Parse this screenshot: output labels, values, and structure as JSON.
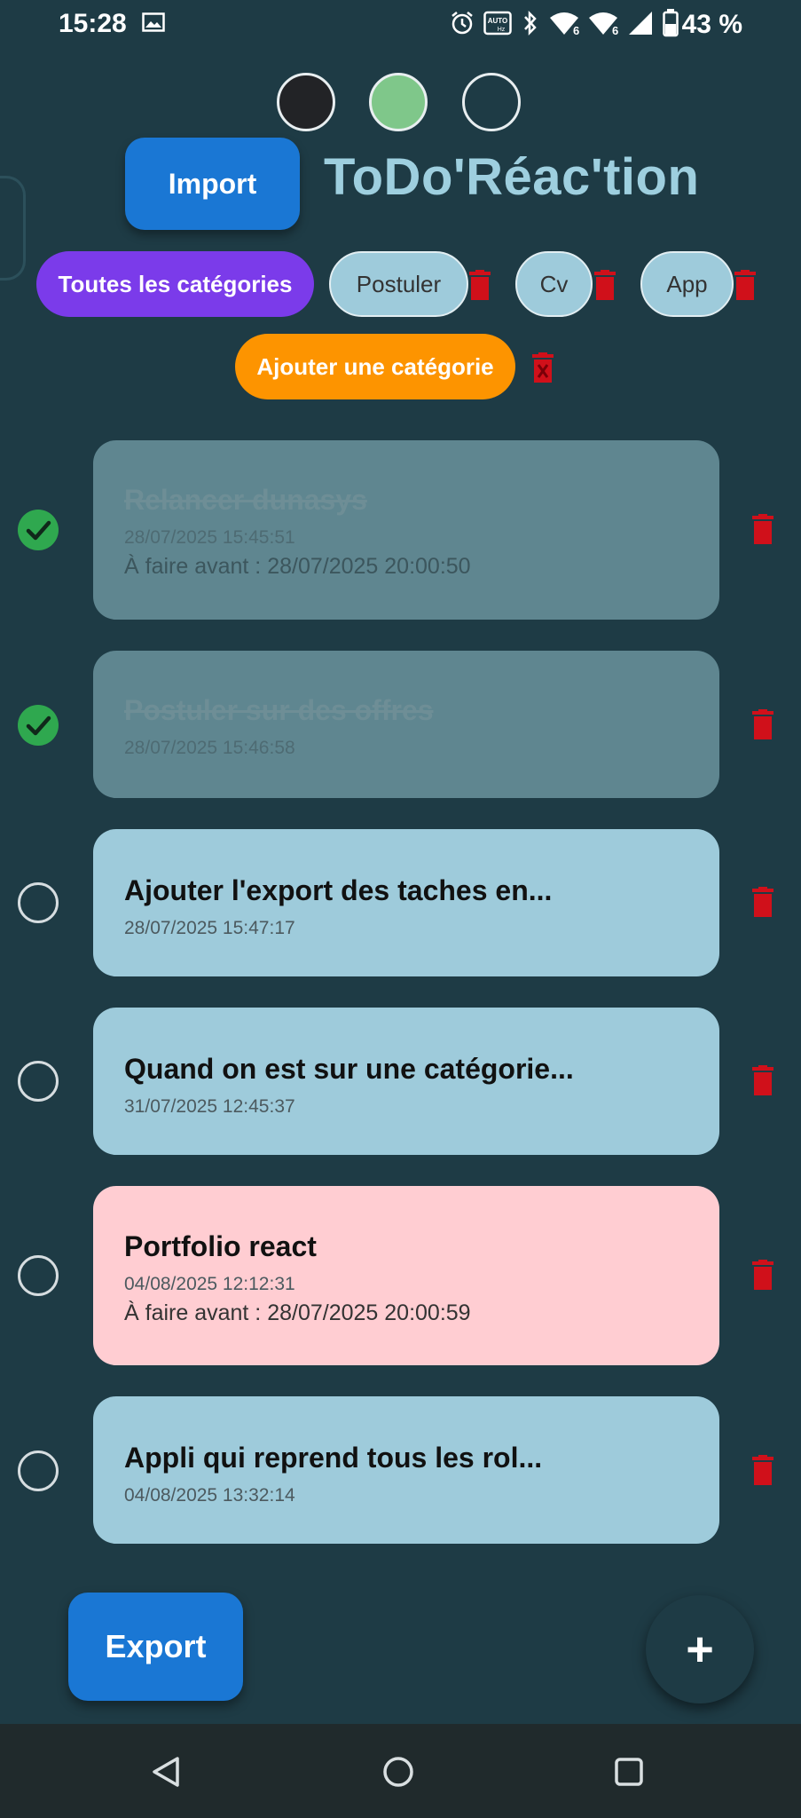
{
  "status_bar": {
    "time": "15:28",
    "battery": "43 %",
    "icons": [
      "image-icon",
      "alarm-icon",
      "auto-hd-icon",
      "bluetooth-icon",
      "wifi-6-icon",
      "wifi-6-icon",
      "signal-icon",
      "battery-icon"
    ]
  },
  "theme_dots": [
    "#222326",
    "#7fc78a",
    "transparent"
  ],
  "header": {
    "import_label": "Import",
    "title": "ToDo'Réac'tion"
  },
  "categories": {
    "all_label": "Toutes les catégories",
    "items": [
      {
        "label": "Postuler"
      },
      {
        "label": "Cv"
      },
      {
        "label": "App"
      }
    ],
    "add_label": "Ajouter une catégorie"
  },
  "tasks": [
    {
      "title": "Relancer dunasys",
      "created": "28/07/2025 15:45:51",
      "due": "À faire avant : 28/07/2025 20:00:50",
      "done": true
    },
    {
      "title": "Postuler sur des offres",
      "created": "28/07/2025 15:46:58",
      "due": "",
      "done": true
    },
    {
      "title": "Ajouter l'export des taches en...",
      "created": "28/07/2025 15:47:17",
      "due": "",
      "done": false
    },
    {
      "title": "Quand on est sur une catégorie...",
      "created": "31/07/2025 12:45:37",
      "due": "",
      "done": false
    },
    {
      "title": "Portfolio react",
      "created": "04/08/2025 12:12:31",
      "due": "À faire avant : 28/07/2025 20:00:59",
      "done": false,
      "overdue": true
    },
    {
      "title": "Appli qui reprend tous les rol...",
      "created": "04/08/2025 13:32:14",
      "due": "",
      "done": false
    }
  ],
  "footer": {
    "export_label": "Export",
    "add_symbol": "+"
  },
  "colors": {
    "background": "#1e3b45",
    "primary": "#1a77d4",
    "accent_purple": "#7b3bea",
    "accent_orange": "#fd9400",
    "delete_red": "#d0101a",
    "done_check": "#2fa84f"
  }
}
